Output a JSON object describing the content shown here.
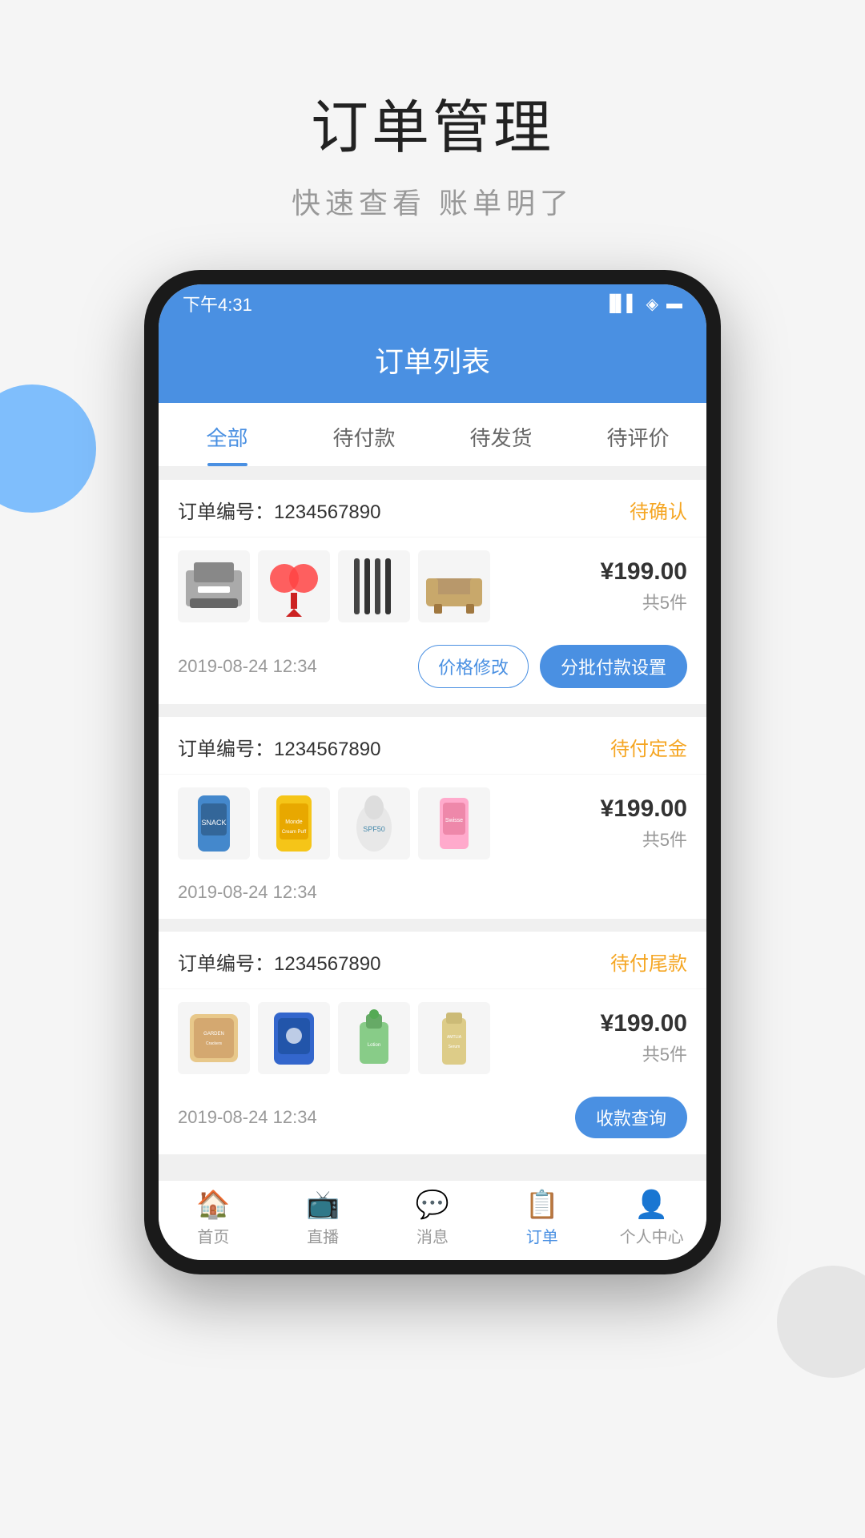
{
  "page": {
    "title": "订单管理",
    "subtitle": "快速查看  账单明了"
  },
  "status_bar": {
    "time": "下午4:31",
    "signal": "📶",
    "wifi": "WiFi",
    "battery": "🔋"
  },
  "app_header": {
    "title": "订单列表"
  },
  "tabs": [
    {
      "label": "全部",
      "active": true
    },
    {
      "label": "待付款",
      "active": false
    },
    {
      "label": "待发货",
      "active": false
    },
    {
      "label": "待评价",
      "active": false
    }
  ],
  "orders": [
    {
      "order_number_label": "订单编号：",
      "order_number": "1234567890",
      "status": "待确认",
      "status_class": "status-confirm",
      "price": "¥199.00",
      "count": "共5件",
      "date": "2019-08-24 12:34",
      "has_actions": true,
      "actions": [
        {
          "label": "价格修改",
          "type": "outline"
        },
        {
          "label": "分批付款设置",
          "type": "solid"
        }
      ]
    },
    {
      "order_number_label": "订单编号：",
      "order_number": "1234567890",
      "status": "待付定金",
      "status_class": "status-deposit",
      "price": "¥199.00",
      "count": "共5件",
      "date": "2019-08-24 12:34",
      "has_actions": false,
      "actions": []
    },
    {
      "order_number_label": "订单编号：",
      "order_number": "1234567890",
      "status": "待付尾款",
      "status_class": "status-tail",
      "price": "¥199.00",
      "count": "共5件",
      "date": "2019-08-24 12:34",
      "has_actions": true,
      "actions": [
        {
          "label": "收款查询",
          "type": "solid"
        }
      ]
    }
  ],
  "bottom_nav": [
    {
      "label": "首页",
      "icon": "🏠",
      "active": false
    },
    {
      "label": "直播",
      "icon": "📺",
      "active": false
    },
    {
      "label": "消息",
      "icon": "💬",
      "active": false
    },
    {
      "label": "订单",
      "icon": "📋",
      "active": true
    },
    {
      "label": "个人中心",
      "icon": "👤",
      "active": false
    }
  ]
}
